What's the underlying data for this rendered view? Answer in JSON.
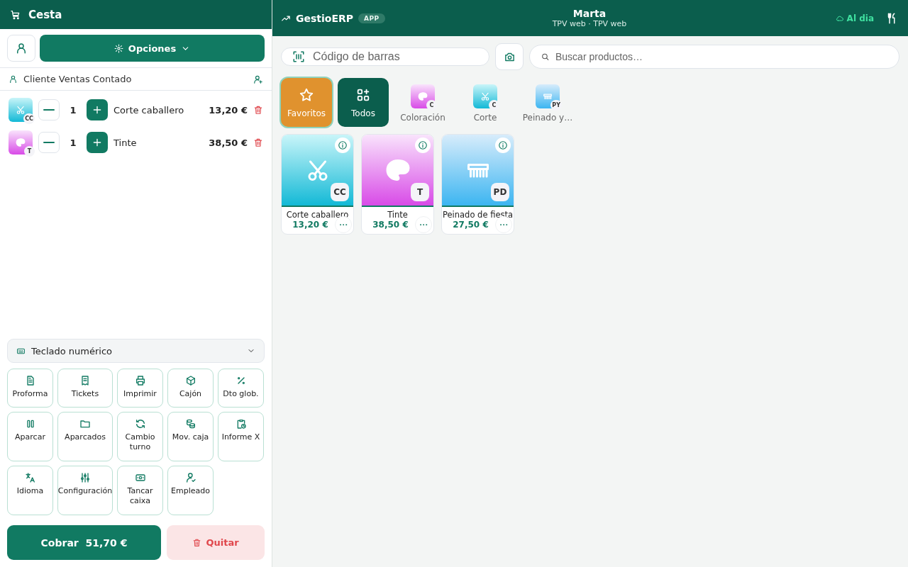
{
  "sidebar": {
    "title": "Cesta",
    "options_button": "Opciones",
    "customer": "Cliente Ventas Contado",
    "cart_items": [
      {
        "name": "Corte caballero",
        "quantity": "1",
        "price": "13,20 €",
        "badge": "CC",
        "kind": "scissors"
      },
      {
        "name": "Tinte",
        "quantity": "1",
        "price": "38,50 €",
        "badge": "T",
        "kind": "palette"
      }
    ],
    "keypad_toggle": {
      "label": "Teclado numérico",
      "expanded": false
    },
    "actions": [
      {
        "label": "Proforma",
        "kind": "document"
      },
      {
        "label": "Tickets",
        "kind": "receipt"
      },
      {
        "label": "Imprimir",
        "kind": "printer"
      },
      {
        "label": "Cajón",
        "kind": "box"
      },
      {
        "label": "Dto glob.",
        "kind": "percent"
      },
      {
        "label": "Aparcar",
        "kind": "pause"
      },
      {
        "label": "Aparcados",
        "kind": "folder"
      },
      {
        "label": "Cambio turno",
        "kind": "refresh"
      },
      {
        "label": "Mov. caja",
        "kind": "coins"
      },
      {
        "label": "Informe X",
        "kind": "clipboard"
      },
      {
        "label": "Idioma",
        "kind": "translate"
      },
      {
        "label": "Configuración",
        "kind": "sliders"
      },
      {
        "label": "Tancar caixa",
        "kind": "banknote"
      },
      {
        "label": "Empleado",
        "kind": "usercheck"
      }
    ],
    "charge_button": "Cobrar  51,70 €",
    "clear_button": "Quitar"
  },
  "header": {
    "app_name": "GestioERP",
    "app_badge": "APP",
    "user": "Marta",
    "subtitle": "TPV web · TPV web",
    "sync_status": "Al dia"
  },
  "toolbar": {
    "barcode_placeholder": "Código de barras",
    "search_placeholder": "Buscar productos…"
  },
  "categories": [
    {
      "label": "Favoritos",
      "kind": "favorites",
      "selected": true
    },
    {
      "label": "Todos",
      "kind": "all",
      "selected": false
    },
    {
      "label": "Coloración",
      "kind": "palette",
      "badge": "C",
      "selected": false
    },
    {
      "label": "Corte",
      "kind": "scissors",
      "badge": "C",
      "selected": false
    },
    {
      "label": "Peinado y…",
      "kind": "comb",
      "badge": "PY",
      "selected": false
    }
  ],
  "products": [
    {
      "name": "Corte caballero",
      "price": "13,20 €",
      "badge": "CC",
      "kind": "scissors"
    },
    {
      "name": "Tinte",
      "price": "38,50 €",
      "badge": "T",
      "kind": "palette"
    },
    {
      "name": "Peinado de fiesta",
      "price": "27,50 €",
      "badge": "PD",
      "kind": "comb"
    }
  ]
}
